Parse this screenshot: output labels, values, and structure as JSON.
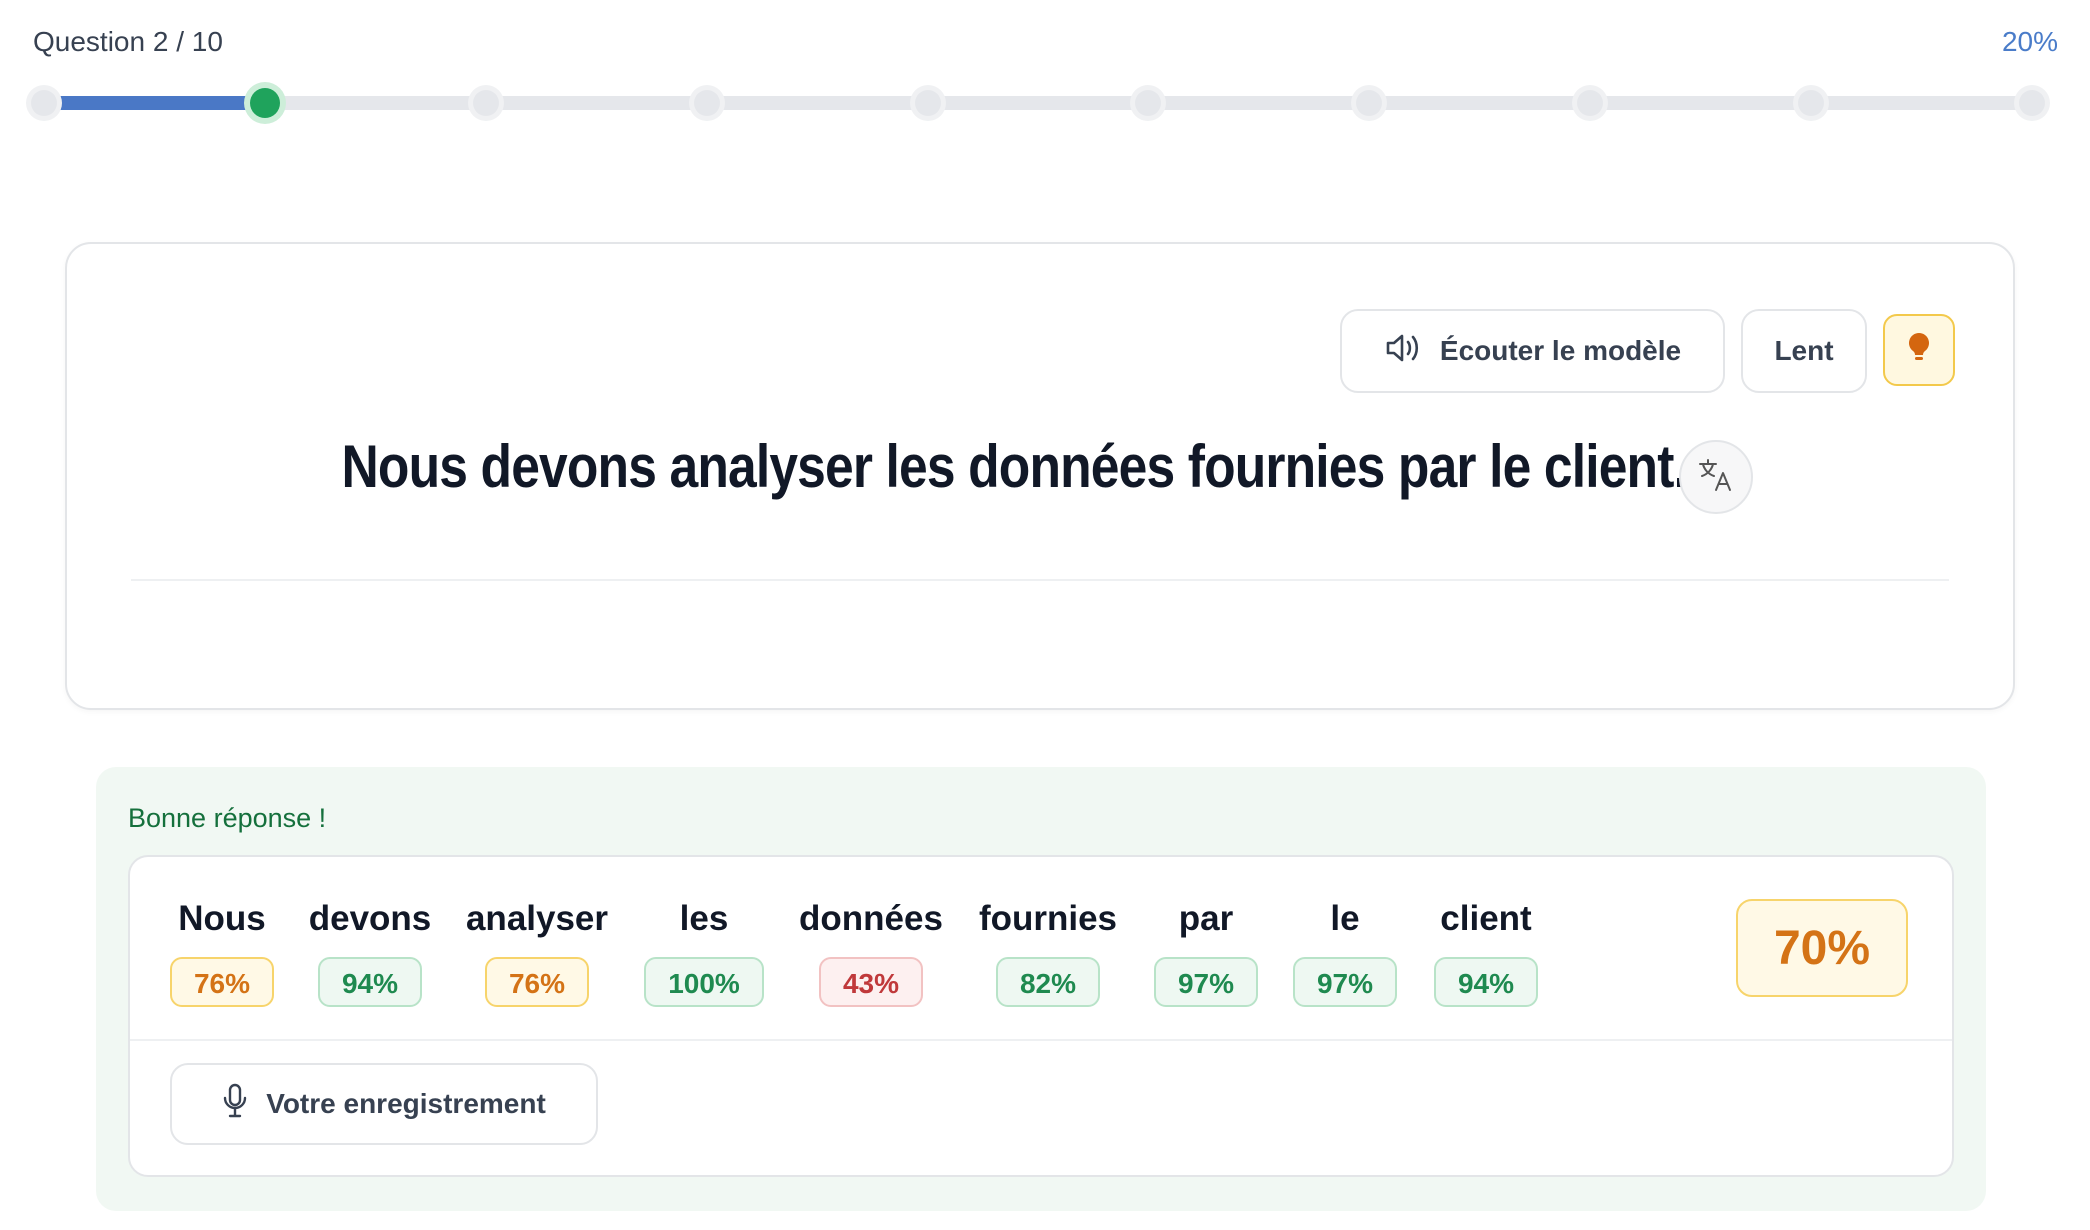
{
  "progress": {
    "label": "Question 2 / 10",
    "percent_text": "20%",
    "current_step": 2,
    "total_steps": 10,
    "fraction": 0.2
  },
  "exercise": {
    "listen_label": "Écouter le modèle",
    "slow_label": "Lent",
    "hint_icon": "lightbulb-icon",
    "translate_icon": "translate-icon",
    "sentence": "Nous devons analyser les données fournies par le client."
  },
  "result": {
    "title": "Bonne réponse !",
    "overall_score": "70%",
    "words": [
      {
        "word": "Nous",
        "score": "76%",
        "level": "orange"
      },
      {
        "word": "devons",
        "score": "94%",
        "level": "green"
      },
      {
        "word": "analyser",
        "score": "76%",
        "level": "orange"
      },
      {
        "word": "les",
        "score": "100%",
        "level": "green"
      },
      {
        "word": "données",
        "score": "43%",
        "level": "red"
      },
      {
        "word": "fournies",
        "score": "82%",
        "level": "green"
      },
      {
        "word": "par",
        "score": "97%",
        "level": "green"
      },
      {
        "word": "le",
        "score": "97%",
        "level": "green"
      },
      {
        "word": "client",
        "score": "94%",
        "level": "green"
      }
    ],
    "recording_label": "Votre enregistrement",
    "recording_icon": "microphone-icon"
  },
  "colors": {
    "accent_blue": "#4a78c6",
    "success_green": "#1fa35c",
    "warning_orange": "#d47316",
    "error_red": "#c0393b"
  }
}
